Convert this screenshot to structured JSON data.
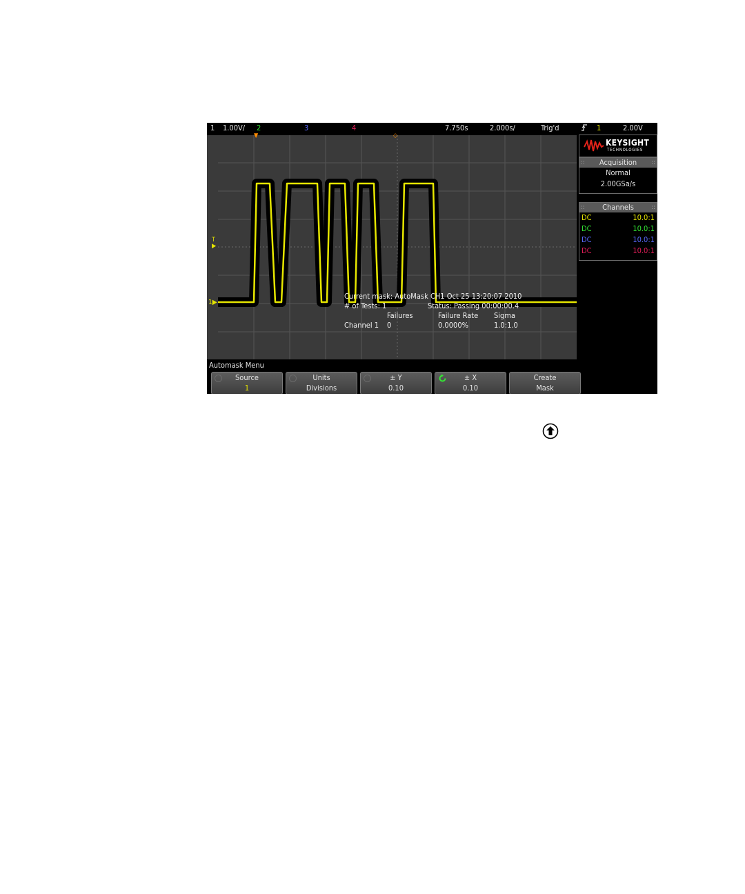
{
  "status_bar": {
    "ch1_label": "1",
    "ch1_scale": "1.00V/",
    "ch2_label": "2",
    "ch3_label": "3",
    "ch4_label": "4",
    "time_delay": "7.750s",
    "time_scale": "2.000s/",
    "trigger_state": "Trig'd",
    "trigger_icon": "rising-edge-icon",
    "trigger_source": "1",
    "trigger_level": "2.00V"
  },
  "colors": {
    "ch1": "#e6e600",
    "ch2": "#33e633",
    "ch3": "#5a6aff",
    "ch4": "#e61e5a",
    "accent": "#ff8c00"
  },
  "brand": {
    "name": "KEYSIGHT",
    "subtitle": "TECHNOLOGIES"
  },
  "acquisition": {
    "header": "Acquisition",
    "mode": "Normal",
    "rate": "2.00GSa/s"
  },
  "channels": {
    "header": "Channels",
    "rows": [
      {
        "coupling": "DC",
        "probe": "10.0:1"
      },
      {
        "coupling": "DC",
        "probe": "10.0:1"
      },
      {
        "coupling": "DC",
        "probe": "10.0:1"
      },
      {
        "coupling": "DC",
        "probe": "10.0:1"
      }
    ]
  },
  "mask_results": {
    "current_mask": "Current mask: AutoMask CH1 Oct 25 13:20:07 2010",
    "tests": "# of Tests: 1",
    "status": "Status: Passing 00:00:00.4",
    "col_failures": "Failures",
    "col_rate": "Failure Rate",
    "col_sigma": "Sigma",
    "row_label": "Channel 1",
    "row_failures": "0",
    "row_rate": "0.0000%",
    "row_sigma": "1.0:1.0"
  },
  "ground_marker": "1",
  "trigger_marker": "T",
  "menu": {
    "title": "Automask Menu",
    "softkeys": [
      {
        "line1": "Source",
        "line2": "1"
      },
      {
        "line1": "Units",
        "line2": "Divisions"
      },
      {
        "line1": "± Y",
        "line2": "0.10"
      },
      {
        "line1": "± X",
        "line2": "0.10"
      },
      {
        "line1": "Create",
        "line2": "Mask"
      }
    ]
  },
  "page_icon": "up-arrow-circle-icon"
}
